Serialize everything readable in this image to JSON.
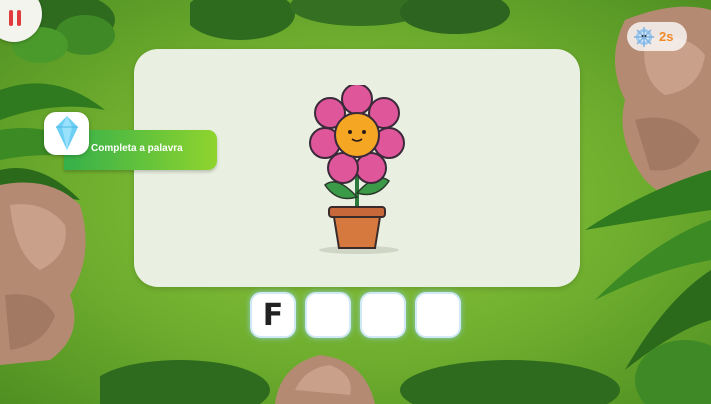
{
  "hud": {
    "pause_icon": "pause-icon",
    "timer_icon": "snowflake-character-icon",
    "timer_text": "2s",
    "timer_color": "#f08a2a"
  },
  "instruction": {
    "text": "Completa a palavra",
    "icon": "crystal-gem-icon"
  },
  "puzzle": {
    "image": "flower-in-pot",
    "letters": [
      "F",
      "",
      "",
      ""
    ]
  },
  "colors": {
    "banner_start": "#35b04a",
    "banner_end": "#8fd42e",
    "petal": "#e0569a",
    "pause_red": "#e0393e"
  }
}
